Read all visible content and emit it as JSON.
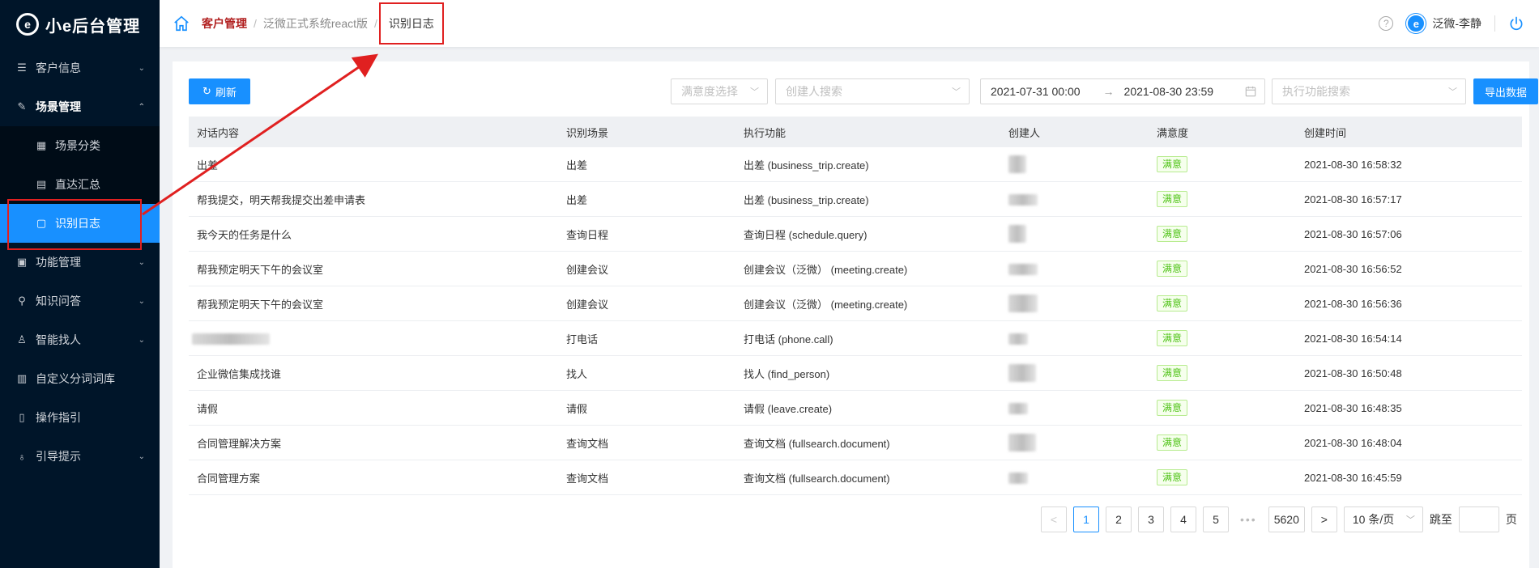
{
  "app": {
    "logo_mark": "e",
    "logo_text": "小e后台管理"
  },
  "sidebar": {
    "items": [
      {
        "label": "客户信息",
        "icon": "list-icon",
        "arrow": "⌄"
      },
      {
        "label": "场景管理",
        "icon": "edit-icon",
        "arrow": "⌃"
      },
      {
        "label": "场景分类",
        "icon": "category-icon",
        "sub": true
      },
      {
        "label": "直达汇总",
        "icon": "summary-icon",
        "sub": true
      },
      {
        "label": "识别日志",
        "icon": "log-icon",
        "sub": true,
        "active": true
      },
      {
        "label": "功能管理",
        "icon": "function-icon",
        "arrow": "⌄"
      },
      {
        "label": "知识问答",
        "icon": "search-icon",
        "arrow": "⌄"
      },
      {
        "label": "智能找人",
        "icon": "user-icon",
        "arrow": "⌄"
      },
      {
        "label": "自定义分词词库",
        "icon": "dictionary-icon"
      },
      {
        "label": "操作指引",
        "icon": "guide-icon"
      },
      {
        "label": "引导提示",
        "icon": "bulb-icon",
        "arrow": "⌄"
      }
    ]
  },
  "header": {
    "breadcrumbs": [
      "客户管理",
      "泛微正式系统react版",
      "识别日志"
    ],
    "user_name": "泛微-李静",
    "avatar_letter": "e",
    "help_glyph": "?"
  },
  "toolbar": {
    "refresh_label": "刷新",
    "satisfaction_placeholder": "满意度选择",
    "creator_placeholder": "创建人搜索",
    "date_start": "2021-07-31 00:00",
    "date_arrow": "→",
    "date_end": "2021-08-30 23:59",
    "function_placeholder": "执行功能搜索",
    "export_label": "导出数据"
  },
  "table": {
    "columns": [
      "对话内容",
      "识别场景",
      "执行功能",
      "创建人",
      "满意度",
      "创建时间"
    ],
    "rows": [
      {
        "content": "出差",
        "scene": "出差",
        "function": "出差 (business_trip.create)",
        "satisfaction": "满意",
        "time": "2021-08-30 16:58:32"
      },
      {
        "content": "帮我提交，明天帮我提交出差申请表",
        "scene": "出差",
        "function": "出差 (business_trip.create)",
        "satisfaction": "满意",
        "time": "2021-08-30 16:57:17"
      },
      {
        "content": "我今天的任务是什么",
        "scene": "查询日程",
        "function": "查询日程 (schedule.query)",
        "satisfaction": "满意",
        "time": "2021-08-30 16:57:06"
      },
      {
        "content": "帮我预定明天下午的会议室",
        "scene": "创建会议",
        "function": "创建会议（泛微） (meeting.create)",
        "satisfaction": "满意",
        "time": "2021-08-30 16:56:52"
      },
      {
        "content": "帮我预定明天下午的会议室",
        "scene": "创建会议",
        "function": "创建会议（泛微） (meeting.create)",
        "satisfaction": "满意",
        "time": "2021-08-30 16:56:36"
      },
      {
        "content": "",
        "scene": "打电话",
        "function": "打电话 (phone.call)",
        "satisfaction": "满意",
        "time": "2021-08-30 16:54:14"
      },
      {
        "content": "企业微信集成找谁",
        "scene": "找人",
        "function": "找人 (find_person)",
        "satisfaction": "满意",
        "time": "2021-08-30 16:50:48"
      },
      {
        "content": "请假",
        "scene": "请假",
        "function": "请假 (leave.create)",
        "satisfaction": "满意",
        "time": "2021-08-30 16:48:35"
      },
      {
        "content": "合同管理解决方案",
        "scene": "查询文档",
        "function": "查询文档 (fullsearch.document)",
        "satisfaction": "满意",
        "time": "2021-08-30 16:48:04"
      },
      {
        "content": "合同管理方案",
        "scene": "查询文档",
        "function": "查询文档 (fullsearch.document)",
        "satisfaction": "满意",
        "time": "2021-08-30 16:45:59"
      }
    ]
  },
  "pagination": {
    "prev": "<",
    "pages": [
      "1",
      "2",
      "3",
      "4",
      "5"
    ],
    "dots": "•••",
    "last": "5620",
    "next": ">",
    "page_size": "10 条/页",
    "jump_label": "跳至",
    "page_label": "页"
  },
  "colors": {
    "sidebar_bg": "#001529",
    "accent": "#1890ff",
    "annotation": "#e02020",
    "tag_green": "#52c41a"
  }
}
